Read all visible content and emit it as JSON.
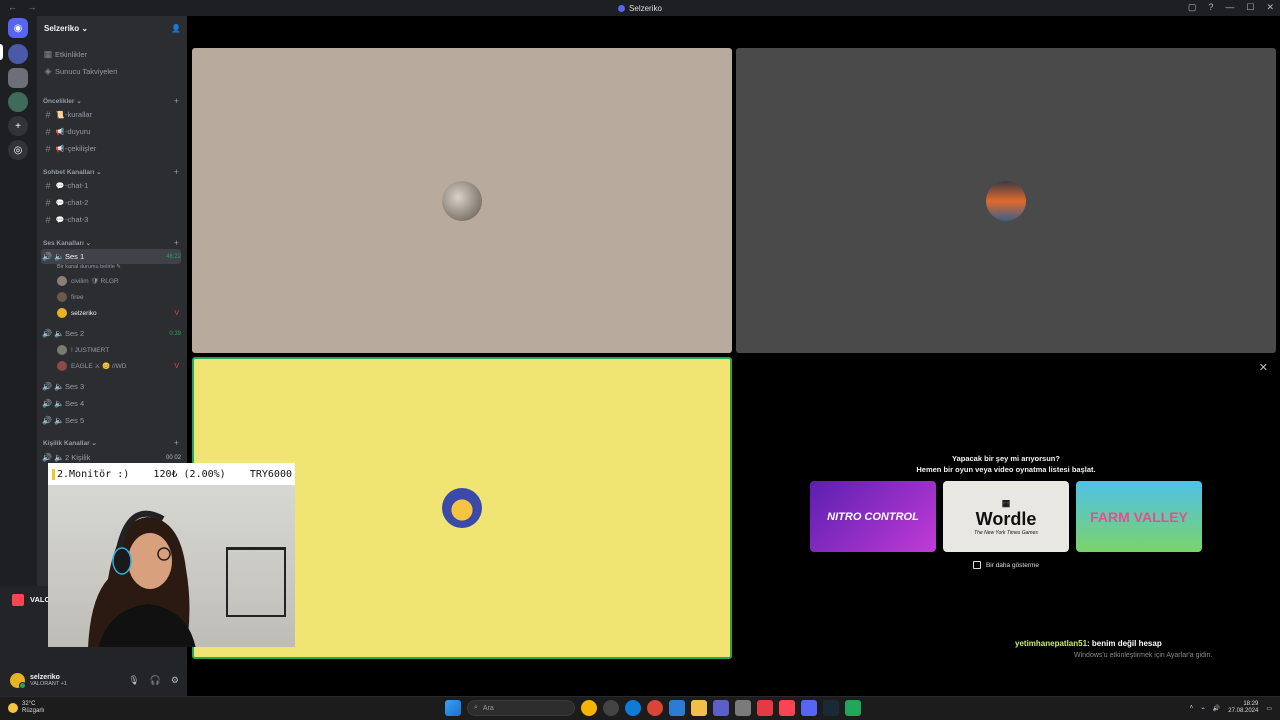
{
  "window": {
    "title": "Selzeriko",
    "nav_arrows": "← →",
    "buttons": [
      "▢",
      "?",
      "—",
      "☐",
      "✕"
    ]
  },
  "server": {
    "name": "Selzeriko ⌄",
    "top_items": [
      {
        "icon": "calendar-icon",
        "label": "Etkinlikler"
      },
      {
        "icon": "boost-icon",
        "label": "Sunucu Takviyeleri"
      }
    ],
    "categories": [
      {
        "label": "Öncelikler ⌄",
        "channels": [
          {
            "emoji": "📜",
            "label": "-kurallar"
          },
          {
            "emoji": "📢",
            "label": "-duyuru"
          },
          {
            "emoji": "📢",
            "label": "-çekilişler"
          }
        ]
      },
      {
        "label": "Sohbet Kanalları ⌄",
        "channels": [
          {
            "emoji": "💬",
            "label": "-chat-1"
          },
          {
            "emoji": "💬",
            "label": "-chat-2"
          },
          {
            "emoji": "💬",
            "label": "-chat-3"
          }
        ]
      },
      {
        "label": "Ses Kanalları ⌄"
      },
      {
        "label": "Kişilik Kanallar ⌄"
      }
    ],
    "voice": [
      {
        "label": "Ses 1",
        "timer": "46:22",
        "status": "Bir kanal durumu belirle ✎",
        "members": [
          {
            "name": "civilim 🛡 RLGR",
            "badge": ""
          },
          {
            "name": "firee",
            "badge": ""
          },
          {
            "name": "selzeriko",
            "badge": "V"
          }
        ]
      },
      {
        "label": "Ses 2",
        "timer": "0:39",
        "members": [
          {
            "name": "! JUSTMERT",
            "badge": ""
          },
          {
            "name": "EAGLE ⚔ 😊 //WD",
            "badge": "V"
          }
        ]
      },
      {
        "label": "Ses 3"
      },
      {
        "label": "Ses 4"
      },
      {
        "label": "Ses 5"
      },
      {
        "label": "2 Kişilik",
        "timer": "00 02"
      }
    ],
    "voice_panel_game": "VALO"
  },
  "user": {
    "name": "selzeriko",
    "status": "VALORANT +1"
  },
  "overlay": {
    "left": "2.Monitör :)",
    "mid": "120₺ (2.00%)",
    "right": "TRY6000"
  },
  "activity": {
    "line1": "Yapacak bir şey mi arıyorsun?",
    "line2": "Hemen bir oyun veya video oynatma listesi başlat.",
    "cards": [
      {
        "title": "NITRO CONTROL",
        "sub": ""
      },
      {
        "title": "Wordle",
        "sub": "The New York Times Games"
      },
      {
        "title": "FARM VALLEY",
        "sub": ""
      }
    ],
    "dont_show": "Bir daha gösterme"
  },
  "chat": {
    "user": "yetimhanepatlan51",
    "text": ": benim değil hesap"
  },
  "windows_watermark": "Windows'u etkinleştirmek için Ayarlar'a gidin.",
  "taskbar": {
    "temp": "32°C",
    "weather": "Rüzgarlı",
    "search_placeholder": "Ara",
    "time": "18:29",
    "date": "27.08.2024"
  },
  "colors": {
    "accent": "#5865f2",
    "online": "#23a55a",
    "tile1": "#b9aa9e",
    "tile2": "#4a4a4a",
    "tile3": "#f0e473"
  }
}
